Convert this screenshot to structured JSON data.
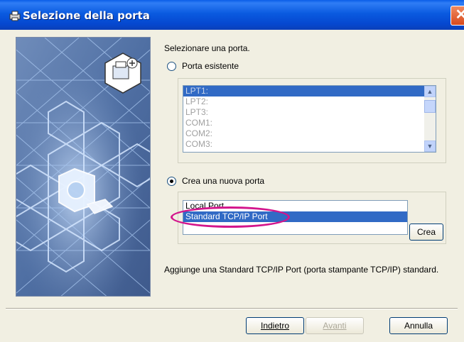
{
  "window": {
    "title": "Selezione della porta",
    "close_symbol": "✕"
  },
  "main": {
    "instruction": "Selezionare una porta.",
    "existing_port_label": "Porta esistente",
    "existing_ports": [
      "LPT1:",
      "LPT2:",
      "LPT3:",
      "COM1:",
      "COM2:",
      "COM3:"
    ],
    "existing_selected": "LPT1:",
    "new_port_label": "Crea una nuova porta",
    "new_port_types": [
      "Local Port",
      "Standard TCP/IP Port"
    ],
    "new_selected": "Standard TCP/IP Port",
    "create_button": "Crea",
    "description": "Aggiunge una Standard TCP/IP Port (porta stampante TCP/IP) standard."
  },
  "footer": {
    "back_button": "Indietro",
    "next_button": "Avanti",
    "cancel_button": "Annulla"
  },
  "colors": {
    "title_bar": "#0a5ae0",
    "selection": "#316ac5",
    "highlight_oval": "#d3158c"
  },
  "icons": [
    "printer-wizard-icon",
    "network-printer-add-icon",
    "close-icon",
    "scroll-up-icon",
    "scroll-down-icon"
  ]
}
